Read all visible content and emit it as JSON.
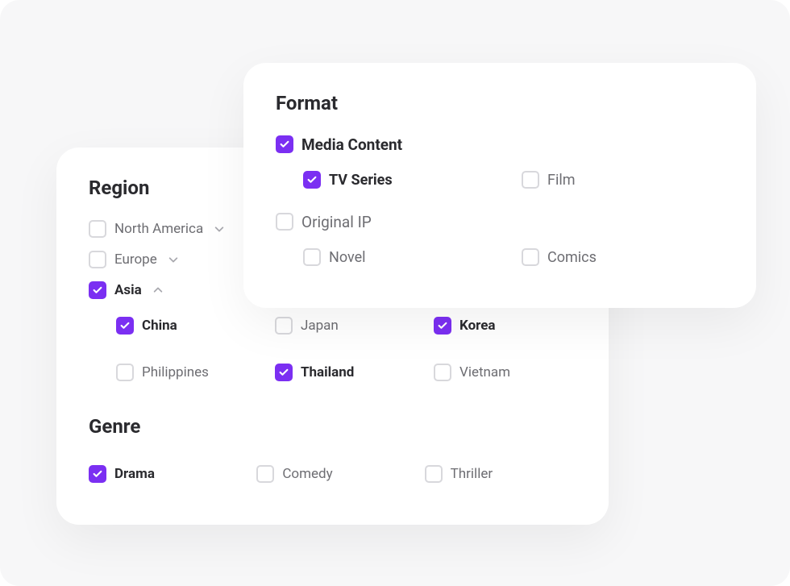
{
  "colors": {
    "accent": "#7b2ff2"
  },
  "region": {
    "title": "Region",
    "items": [
      {
        "label": "North America",
        "checked": false,
        "expanded": false,
        "has_children": true
      },
      {
        "label": "Europe",
        "checked": false,
        "expanded": false,
        "has_children": true
      },
      {
        "label": "Asia",
        "checked": true,
        "expanded": true,
        "has_children": true,
        "children": [
          {
            "label": "China",
            "checked": true
          },
          {
            "label": "Japan",
            "checked": false
          },
          {
            "label": "Korea",
            "checked": true
          },
          {
            "label": "Philippines",
            "checked": false
          },
          {
            "label": "Thailand",
            "checked": true
          },
          {
            "label": "Vietnam",
            "checked": false
          }
        ]
      }
    ]
  },
  "genre": {
    "title": "Genre",
    "items": [
      {
        "label": "Drama",
        "checked": true
      },
      {
        "label": "Comedy",
        "checked": false
      },
      {
        "label": "Thriller",
        "checked": false
      }
    ]
  },
  "format": {
    "title": "Format",
    "groups": [
      {
        "label": "Media Content",
        "checked": true,
        "children": [
          {
            "label": "TV Series",
            "checked": true
          },
          {
            "label": "Film",
            "checked": false
          }
        ]
      },
      {
        "label": "Original IP",
        "checked": false,
        "children": [
          {
            "label": "Novel",
            "checked": false
          },
          {
            "label": "Comics",
            "checked": false
          }
        ]
      }
    ]
  }
}
